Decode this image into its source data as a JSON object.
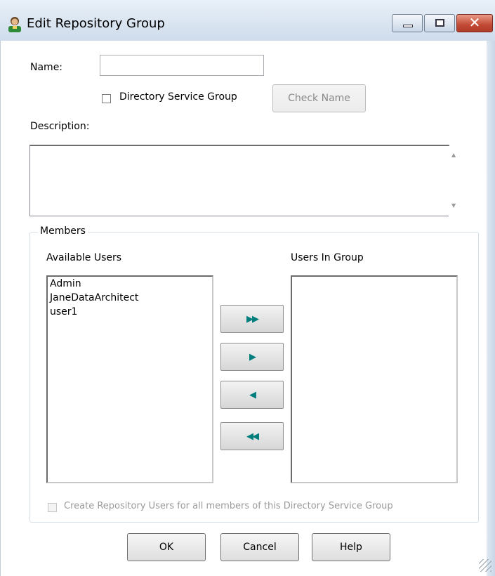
{
  "window": {
    "title": "Edit Repository Group",
    "icon": "user-group-icon",
    "controls": {
      "minimize": "minimize-icon",
      "maximize": "maximize-icon",
      "close_label": "✕"
    }
  },
  "form": {
    "name_label": "Name:",
    "name_value": "",
    "directory_service_group_label": "Directory Service Group",
    "directory_service_group_checked": false,
    "check_name_label": "Check Name",
    "description_label": "Description:",
    "description_value": ""
  },
  "members": {
    "legend": "Members",
    "available_users_label": "Available Users",
    "available_users": [
      "Admin",
      "JaneDataArchitect",
      "user1"
    ],
    "users_in_group_label": "Users In Group",
    "users_in_group": [],
    "move_buttons": {
      "add_all": "double-right-arrow-icon",
      "add_one": "right-arrow-icon",
      "remove_one": "left-arrow-icon",
      "remove_all": "double-left-arrow-icon"
    },
    "create_users_label": "Create Repository Users for all members of this Directory Service Group",
    "create_users_checked": false
  },
  "buttons": {
    "ok": "OK",
    "cancel": "Cancel",
    "help": "Help"
  },
  "colors": {
    "arrow": "#007d7d",
    "close_button": "#c24a35"
  }
}
